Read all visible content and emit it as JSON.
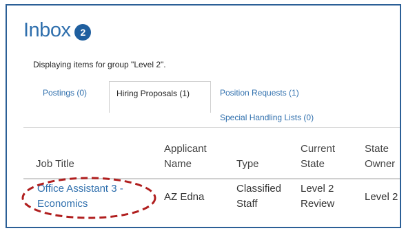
{
  "inbox": {
    "title": "Inbox",
    "badge_count": "2"
  },
  "group_message": "Displaying items for group \"Level 2\".",
  "tabs": [
    {
      "label": "Postings (0)",
      "active": false
    },
    {
      "label": "Hiring Proposals (1)",
      "active": true
    },
    {
      "label": "Position Requests (1)",
      "active": false
    },
    {
      "label": "Special Handling Lists (0)",
      "active": false
    }
  ],
  "table": {
    "headers": {
      "job_title": "Job Title",
      "applicant_line1": "Applicant",
      "applicant_line2": "Name",
      "type": "Type",
      "state_line1": "Current",
      "state_line2": "State",
      "owner_line1": "State",
      "owner_line2": "Owner"
    },
    "rows": [
      {
        "job_title_line1": "Office Assistant 3 -",
        "job_title_line2": "Economics",
        "applicant": "AZ Edna",
        "type_line1": "Classified",
        "type_line2": "Staff",
        "state_line1": "Level 2",
        "state_line2": "Review",
        "owner": "Level 2"
      }
    ]
  },
  "colors": {
    "accent": "#2f6fad",
    "badge": "#1f5f9f",
    "frame_border": "#2b5f96",
    "annotation": "#b01e1e"
  }
}
